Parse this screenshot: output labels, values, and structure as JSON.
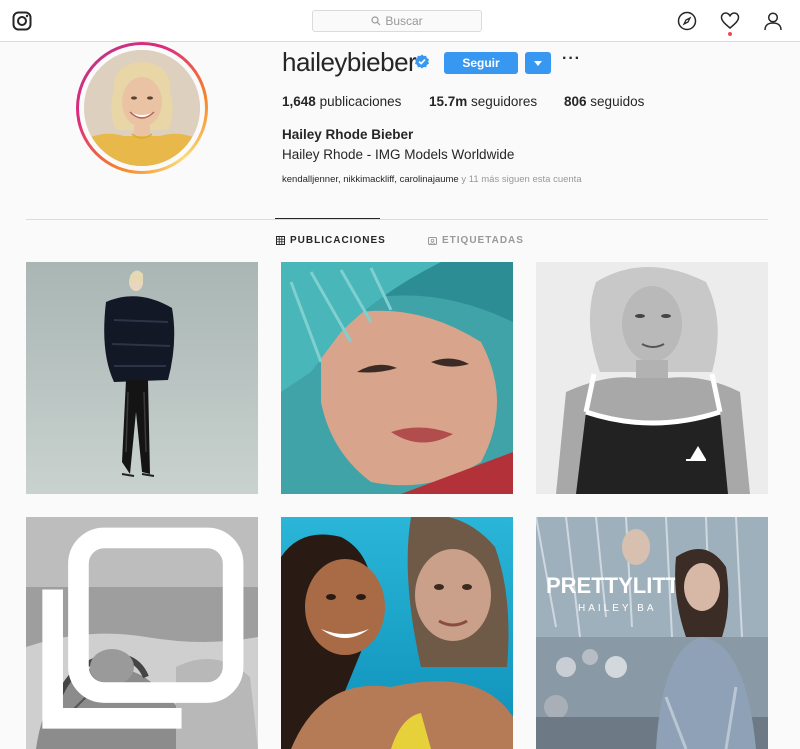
{
  "nav": {
    "search_placeholder": "Buscar",
    "icons": [
      "instagram-logo-icon",
      "search-icon",
      "compass-icon",
      "heart-icon",
      "profile-icon"
    ],
    "notification_color": "#ed4956"
  },
  "profile": {
    "username": "haileybieber",
    "verified": true,
    "follow_label": "Seguir",
    "more_label": "···",
    "stats": {
      "posts_count": "1,648",
      "posts_label": "publicaciones",
      "followers_count": "15.7m",
      "followers_label": "seguidores",
      "following_count": "806",
      "following_label": "seguidos"
    },
    "full_name": "Hailey Rhode Bieber",
    "bio": "Hailey Rhode - IMG Models Worldwide",
    "followed_by_names": "kendalljenner, nikkimackliff, carolinajaume",
    "followed_by_suffix": " y 11 más siguen esta cuenta"
  },
  "tabs": [
    {
      "label": "PUBLICACIONES",
      "active": true
    },
    {
      "label": "ETIQUETADAS",
      "active": false
    }
  ],
  "posts": [
    {
      "description": "fashion",
      "image": "puffer-jacket-photo"
    },
    {
      "description": "portrait",
      "image": "blue-hair-closeup-photo"
    },
    {
      "description": "portrait",
      "image": "bw-tank-top-portrait-photo"
    },
    {
      "description": "couple",
      "image": "bw-beach-couple-photo",
      "multiple": true
    },
    {
      "description": "friends",
      "image": "beach-friends-selfie-photo"
    },
    {
      "description": "event",
      "image": "prettylittlething-event-photo"
    }
  ],
  "colors": {
    "accent": "#3897f0",
    "text": "#262626",
    "muted": "#999999",
    "border": "#dbdbdb",
    "background": "#fafafa"
  },
  "event_banner_text": "PRETTYLITT",
  "event_banner_sub": "HAILEY BA"
}
